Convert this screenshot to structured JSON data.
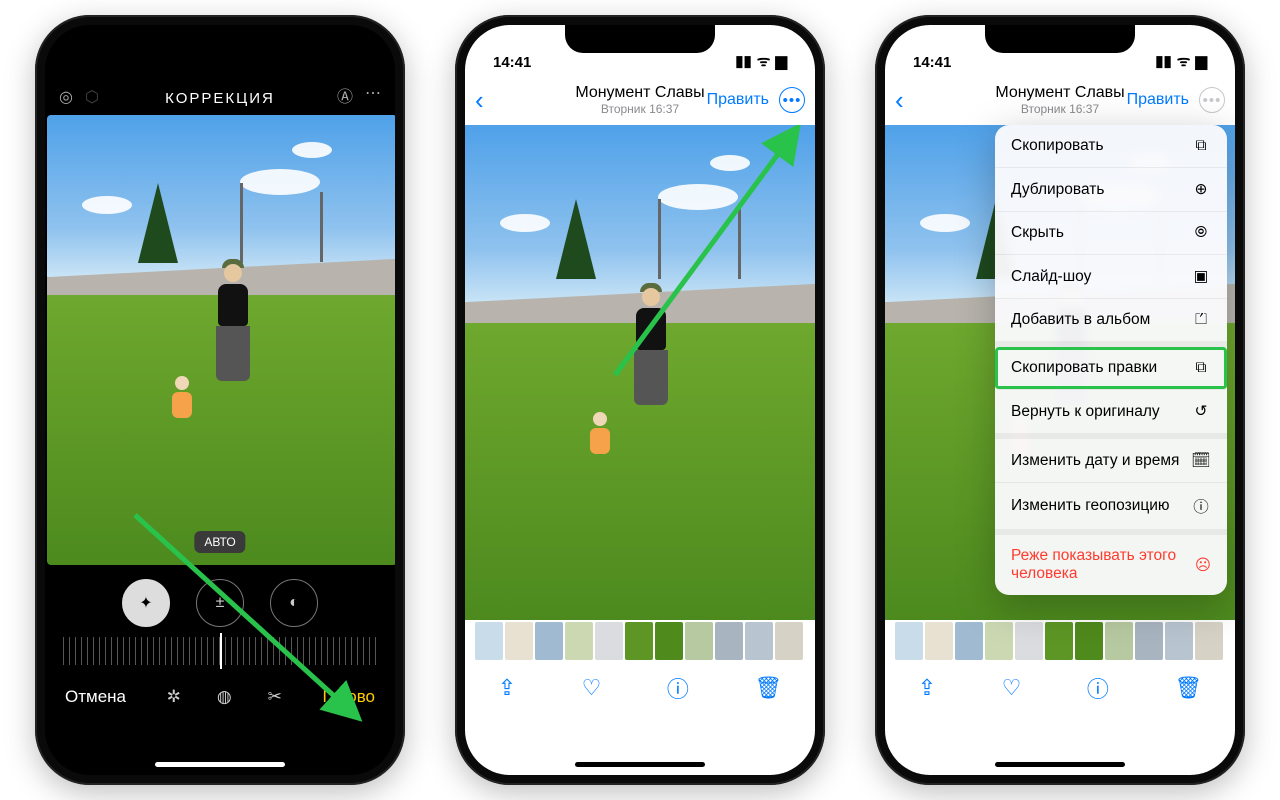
{
  "phone1": {
    "title": "КОРРЕКЦИЯ",
    "auto_pill": "АВТО",
    "cancel": "Отмена",
    "done": "Готово"
  },
  "phone2": {
    "time": "14:41",
    "title": "Монумент Славы",
    "subtitle": "Вторник 16:37",
    "edit": "Править"
  },
  "phone3": {
    "time": "14:41",
    "title": "Монумент Славы",
    "subtitle": "Вторник 16:37",
    "edit": "Править",
    "menu": [
      {
        "label": "Скопировать",
        "icon": "⧉",
        "sep": false
      },
      {
        "label": "Дублировать",
        "icon": "⊕",
        "sep": false
      },
      {
        "label": "Скрыть",
        "icon": "⦾",
        "sep": false
      },
      {
        "label": "Слайд-шоу",
        "icon": "▣",
        "sep": false
      },
      {
        "label": "Добавить в альбом",
        "icon": "⏍",
        "sep": true
      },
      {
        "label": "Скопировать правки",
        "icon": "⧉",
        "highlight": true
      },
      {
        "label": "Вернуть к оригиналу",
        "icon": "↺",
        "sep": true
      },
      {
        "label": "Изменить дату и время",
        "icon": "🗓",
        "sep": false
      },
      {
        "label": "Изменить геопозицию",
        "icon": "ⓘ",
        "sep": true
      },
      {
        "label": "Реже показывать этого человека",
        "icon": "☹",
        "red": true
      }
    ]
  },
  "thumb_colors": [
    "#c9dce9",
    "#e8e1d2",
    "#9fbad1",
    "#cbd8b2",
    "#dadce0",
    "#5d9625",
    "#4f8a1c",
    "#b7c9a0",
    "#a8b5c0",
    "#b8c4cf",
    "#d6d2c6"
  ]
}
